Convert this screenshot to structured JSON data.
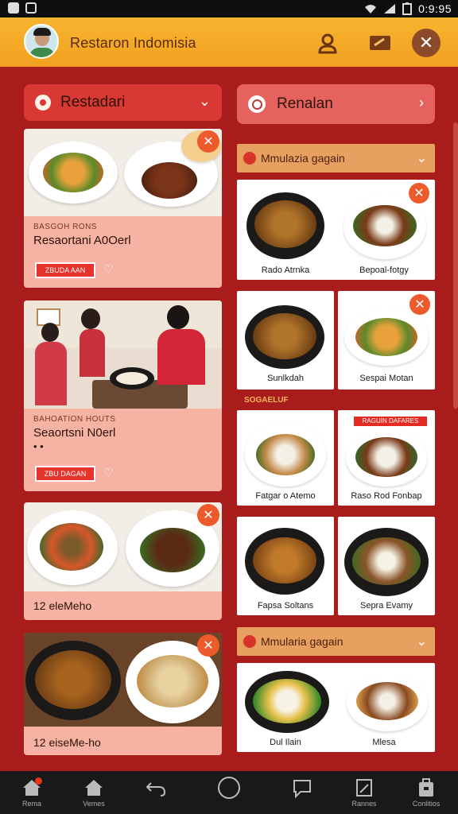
{
  "statusbar": {
    "time": "0:9:95"
  },
  "appbar": {
    "title": "Restaron Indomisia"
  },
  "left_dropdown": {
    "label": "Restadari"
  },
  "right_dropdown": {
    "label": "Renalan"
  },
  "cards": [
    {
      "kicker": "BASGOH RONS",
      "title": "Resaortani A0Oerl",
      "button": "ZBUDA AAN"
    },
    {
      "kicker": "BAHOATION HOUTS",
      "title": "Seaortsni N0erl",
      "dots": "• •",
      "button": "ZBU DAGAN"
    },
    {
      "caption": "12 eleMeho"
    },
    {
      "caption": "12 eiseMe-ho"
    }
  ],
  "sections": [
    {
      "label": "Mmulazia  gagain"
    },
    {
      "label": "Mmularia  gagain"
    }
  ],
  "tiles": [
    {
      "caption": "Rado Atrnka"
    },
    {
      "caption": "Bepoal-fotgy"
    },
    {
      "caption": "Sunlkdah"
    },
    {
      "caption": "Sespai Motan"
    },
    {
      "caption": "Fatgar o Atemo"
    },
    {
      "caption": "Raso Rod Fonbap",
      "tag": "RAGUIN DAFARES"
    },
    {
      "caption": "Fapsa Soltans"
    },
    {
      "caption": "Sepra Evamy"
    },
    {
      "caption": "Dul Ilain"
    },
    {
      "caption": "Mlesa"
    }
  ],
  "mid_label": "SOGAELUF",
  "nav": [
    {
      "label": "Rema"
    },
    {
      "label": "Vemes"
    },
    {
      "label": ""
    },
    {
      "label": ""
    },
    {
      "label": ""
    },
    {
      "label": "Rannes"
    },
    {
      "label": "Conlitios"
    }
  ],
  "colors": {
    "appbar": "#f2a11f",
    "background": "#a81c1c",
    "accent": "#e6332b",
    "card": "#f6b3a4",
    "section": "#e8a060"
  }
}
